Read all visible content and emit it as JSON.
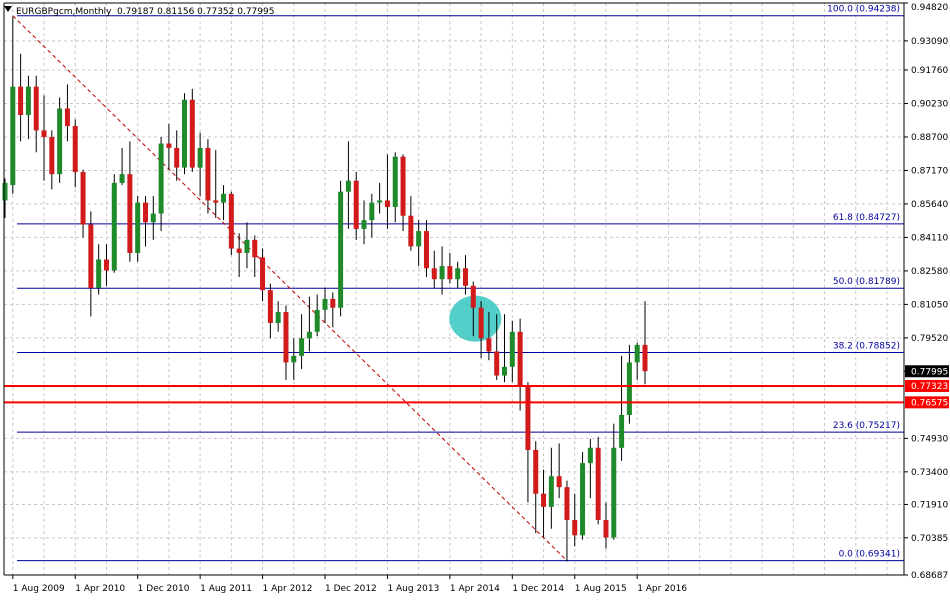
{
  "header": {
    "symbol": "EURGBPgcm,Monthly",
    "ohlc": "0.79187 0.81156 0.77352 0.77995"
  },
  "chart_data": {
    "type": "candlestick",
    "symbol": "EURGBPgcm",
    "timeframe": "Monthly",
    "ylim": [
      0.68687,
      0.9482
    ],
    "y_ticks": [
      "0.94820",
      "0.93090",
      "0.91760",
      "0.90230",
      "0.88700",
      "0.87170",
      "0.85640",
      "0.84110",
      "0.82580",
      "0.81050",
      "0.79520",
      "0.77995",
      "0.74930",
      "0.73400",
      "0.71910",
      "0.70385",
      "0.68687"
    ],
    "x_ticks": [
      "1 Aug 2009",
      "1 Apr 2010",
      "1 Dec 2010",
      "1 Aug 2011",
      "1 Apr 2012",
      "1 Dec 2012",
      "1 Aug 2013",
      "1 Apr 2014",
      "1 Dec 2014",
      "1 Aug 2015",
      "1 Apr 2016"
    ],
    "x_range": [
      "2009-07",
      "2016-05"
    ],
    "grid": true,
    "colors": {
      "bull": "#1f8a2a",
      "bear": "#d11a1a",
      "wick": "#000000",
      "grid": "#c8c8c8",
      "fib": "#0000a0",
      "sr": "#ff0000",
      "trend": "#c00000",
      "highlight": "#35c6c0",
      "price_label": "#000000",
      "sr_label": "#ff0000"
    },
    "fibonacci": [
      {
        "label": "100.0",
        "value": "0.94238"
      },
      {
        "label": "61.8",
        "value": "0.84727"
      },
      {
        "label": "50.0",
        "value": "0.81789"
      },
      {
        "label": "38.2",
        "value": "0.78852"
      },
      {
        "label": "23.6",
        "value": "0.75217"
      },
      {
        "label": "0.0",
        "value": "0.69341"
      }
    ],
    "support_resistance": [
      "0.77323",
      "0.76575"
    ],
    "current_price": "0.77995",
    "trendline": {
      "from_date": "2009-08",
      "from_price": 0.94238,
      "to_date": "2015-07",
      "to_price": 0.69341
    },
    "highlight": {
      "date": "2014-07",
      "price": 0.804
    },
    "candles": [
      {
        "t": "2009-07",
        "o": 0.858,
        "h": 0.868,
        "l": 0.85,
        "c": 0.866
      },
      {
        "t": "2009-08",
        "o": 0.865,
        "h": 0.942,
        "l": 0.861,
        "c": 0.91
      },
      {
        "t": "2009-09",
        "o": 0.91,
        "h": 0.925,
        "l": 0.885,
        "c": 0.897
      },
      {
        "t": "2009-10",
        "o": 0.897,
        "h": 0.915,
        "l": 0.886,
        "c": 0.91
      },
      {
        "t": "2009-11",
        "o": 0.91,
        "h": 0.915,
        "l": 0.88,
        "c": 0.89
      },
      {
        "t": "2009-12",
        "o": 0.89,
        "h": 0.906,
        "l": 0.867,
        "c": 0.887
      },
      {
        "t": "2010-01",
        "o": 0.887,
        "h": 0.89,
        "l": 0.863,
        "c": 0.87
      },
      {
        "t": "2010-02",
        "o": 0.87,
        "h": 0.905,
        "l": 0.866,
        "c": 0.9
      },
      {
        "t": "2010-03",
        "o": 0.9,
        "h": 0.911,
        "l": 0.885,
        "c": 0.892
      },
      {
        "t": "2010-04",
        "o": 0.892,
        "h": 0.895,
        "l": 0.864,
        "c": 0.871
      },
      {
        "t": "2010-05",
        "o": 0.871,
        "h": 0.872,
        "l": 0.841,
        "c": 0.847
      },
      {
        "t": "2010-06",
        "o": 0.847,
        "h": 0.853,
        "l": 0.805,
        "c": 0.818
      },
      {
        "t": "2010-07",
        "o": 0.818,
        "h": 0.838,
        "l": 0.815,
        "c": 0.831
      },
      {
        "t": "2010-08",
        "o": 0.831,
        "h": 0.838,
        "l": 0.819,
        "c": 0.826
      },
      {
        "t": "2010-09",
        "o": 0.826,
        "h": 0.87,
        "l": 0.825,
        "c": 0.866
      },
      {
        "t": "2010-10",
        "o": 0.866,
        "h": 0.882,
        "l": 0.865,
        "c": 0.87
      },
      {
        "t": "2010-11",
        "o": 0.87,
        "h": 0.885,
        "l": 0.83,
        "c": 0.834
      },
      {
        "t": "2010-12",
        "o": 0.834,
        "h": 0.86,
        "l": 0.83,
        "c": 0.857
      },
      {
        "t": "2011-01",
        "o": 0.857,
        "h": 0.86,
        "l": 0.837,
        "c": 0.848
      },
      {
        "t": "2011-02",
        "o": 0.848,
        "h": 0.86,
        "l": 0.84,
        "c": 0.852
      },
      {
        "t": "2011-03",
        "o": 0.852,
        "h": 0.887,
        "l": 0.844,
        "c": 0.884
      },
      {
        "t": "2011-04",
        "o": 0.884,
        "h": 0.893,
        "l": 0.872,
        "c": 0.882
      },
      {
        "t": "2011-05",
        "o": 0.882,
        "h": 0.89,
        "l": 0.867,
        "c": 0.873
      },
      {
        "t": "2011-06",
        "o": 0.873,
        "h": 0.907,
        "l": 0.87,
        "c": 0.904
      },
      {
        "t": "2011-07",
        "o": 0.904,
        "h": 0.909,
        "l": 0.871,
        "c": 0.873
      },
      {
        "t": "2011-08",
        "o": 0.873,
        "h": 0.889,
        "l": 0.86,
        "c": 0.882
      },
      {
        "t": "2011-09",
        "o": 0.882,
        "h": 0.886,
        "l": 0.852,
        "c": 0.858
      },
      {
        "t": "2011-10",
        "o": 0.858,
        "h": 0.881,
        "l": 0.85,
        "c": 0.857
      },
      {
        "t": "2011-11",
        "o": 0.857,
        "h": 0.865,
        "l": 0.849,
        "c": 0.861
      },
      {
        "t": "2011-12",
        "o": 0.861,
        "h": 0.862,
        "l": 0.833,
        "c": 0.836
      },
      {
        "t": "2012-01",
        "o": 0.836,
        "h": 0.843,
        "l": 0.823,
        "c": 0.834
      },
      {
        "t": "2012-02",
        "o": 0.834,
        "h": 0.848,
        "l": 0.827,
        "c": 0.84
      },
      {
        "t": "2012-03",
        "o": 0.84,
        "h": 0.842,
        "l": 0.823,
        "c": 0.832
      },
      {
        "t": "2012-04",
        "o": 0.832,
        "h": 0.836,
        "l": 0.812,
        "c": 0.817
      },
      {
        "t": "2012-05",
        "o": 0.817,
        "h": 0.82,
        "l": 0.795,
        "c": 0.802
      },
      {
        "t": "2012-06",
        "o": 0.802,
        "h": 0.812,
        "l": 0.798,
        "c": 0.807
      },
      {
        "t": "2012-07",
        "o": 0.807,
        "h": 0.81,
        "l": 0.776,
        "c": 0.784
      },
      {
        "t": "2012-08",
        "o": 0.784,
        "h": 0.795,
        "l": 0.776,
        "c": 0.787
      },
      {
        "t": "2012-09",
        "o": 0.787,
        "h": 0.806,
        "l": 0.781,
        "c": 0.795
      },
      {
        "t": "2012-10",
        "o": 0.795,
        "h": 0.814,
        "l": 0.789,
        "c": 0.798
      },
      {
        "t": "2012-11",
        "o": 0.798,
        "h": 0.815,
        "l": 0.796,
        "c": 0.808
      },
      {
        "t": "2012-12",
        "o": 0.808,
        "h": 0.818,
        "l": 0.802,
        "c": 0.813
      },
      {
        "t": "2013-01",
        "o": 0.813,
        "h": 0.816,
        "l": 0.8,
        "c": 0.809
      },
      {
        "t": "2013-02",
        "o": 0.809,
        "h": 0.867,
        "l": 0.805,
        "c": 0.862
      },
      {
        "t": "2013-03",
        "o": 0.862,
        "h": 0.885,
        "l": 0.845,
        "c": 0.867
      },
      {
        "t": "2013-04",
        "o": 0.867,
        "h": 0.871,
        "l": 0.84,
        "c": 0.845
      },
      {
        "t": "2013-05",
        "o": 0.845,
        "h": 0.858,
        "l": 0.838,
        "c": 0.849
      },
      {
        "t": "2013-06",
        "o": 0.849,
        "h": 0.861,
        "l": 0.841,
        "c": 0.857
      },
      {
        "t": "2013-07",
        "o": 0.857,
        "h": 0.866,
        "l": 0.852,
        "c": 0.858
      },
      {
        "t": "2013-08",
        "o": 0.858,
        "h": 0.879,
        "l": 0.845,
        "c": 0.855
      },
      {
        "t": "2013-09",
        "o": 0.855,
        "h": 0.88,
        "l": 0.848,
        "c": 0.878
      },
      {
        "t": "2013-10",
        "o": 0.878,
        "h": 0.879,
        "l": 0.844,
        "c": 0.851
      },
      {
        "t": "2013-11",
        "o": 0.851,
        "h": 0.86,
        "l": 0.835,
        "c": 0.837
      },
      {
        "t": "2013-12",
        "o": 0.837,
        "h": 0.849,
        "l": 0.828,
        "c": 0.844
      },
      {
        "t": "2014-01",
        "o": 0.844,
        "h": 0.849,
        "l": 0.823,
        "c": 0.827
      },
      {
        "t": "2014-02",
        "o": 0.827,
        "h": 0.835,
        "l": 0.818,
        "c": 0.822
      },
      {
        "t": "2014-03",
        "o": 0.822,
        "h": 0.837,
        "l": 0.815,
        "c": 0.828
      },
      {
        "t": "2014-04",
        "o": 0.828,
        "h": 0.834,
        "l": 0.82,
        "c": 0.822
      },
      {
        "t": "2014-05",
        "o": 0.822,
        "h": 0.83,
        "l": 0.818,
        "c": 0.827
      },
      {
        "t": "2014-06",
        "o": 0.827,
        "h": 0.833,
        "l": 0.815,
        "c": 0.819
      },
      {
        "t": "2014-07",
        "o": 0.819,
        "h": 0.821,
        "l": 0.796,
        "c": 0.809
      },
      {
        "t": "2014-08",
        "o": 0.809,
        "h": 0.812,
        "l": 0.786,
        "c": 0.795
      },
      {
        "t": "2014-09",
        "o": 0.795,
        "h": 0.807,
        "l": 0.785,
        "c": 0.789
      },
      {
        "t": "2014-10",
        "o": 0.789,
        "h": 0.806,
        "l": 0.776,
        "c": 0.778
      },
      {
        "t": "2014-11",
        "o": 0.778,
        "h": 0.806,
        "l": 0.775,
        "c": 0.782
      },
      {
        "t": "2014-12",
        "o": 0.782,
        "h": 0.803,
        "l": 0.775,
        "c": 0.798
      },
      {
        "t": "2015-01",
        "o": 0.798,
        "h": 0.804,
        "l": 0.762,
        "c": 0.773
      },
      {
        "t": "2015-02",
        "o": 0.773,
        "h": 0.775,
        "l": 0.72,
        "c": 0.744
      },
      {
        "t": "2015-03",
        "o": 0.744,
        "h": 0.748,
        "l": 0.706,
        "c": 0.724
      },
      {
        "t": "2015-04",
        "o": 0.724,
        "h": 0.735,
        "l": 0.704,
        "c": 0.718
      },
      {
        "t": "2015-05",
        "o": 0.718,
        "h": 0.745,
        "l": 0.708,
        "c": 0.732
      },
      {
        "t": "2015-06",
        "o": 0.732,
        "h": 0.747,
        "l": 0.722,
        "c": 0.727
      },
      {
        "t": "2015-07",
        "o": 0.727,
        "h": 0.73,
        "l": 0.693,
        "c": 0.712
      },
      {
        "t": "2015-08",
        "o": 0.712,
        "h": 0.724,
        "l": 0.7,
        "c": 0.705
      },
      {
        "t": "2015-09",
        "o": 0.705,
        "h": 0.743,
        "l": 0.703,
        "c": 0.738
      },
      {
        "t": "2015-10",
        "o": 0.738,
        "h": 0.749,
        "l": 0.722,
        "c": 0.745
      },
      {
        "t": "2015-11",
        "o": 0.745,
        "h": 0.75,
        "l": 0.71,
        "c": 0.712
      },
      {
        "t": "2015-12",
        "o": 0.712,
        "h": 0.72,
        "l": 0.699,
        "c": 0.704
      },
      {
        "t": "2016-01",
        "o": 0.704,
        "h": 0.756,
        "l": 0.703,
        "c": 0.745
      },
      {
        "t": "2016-02",
        "o": 0.745,
        "h": 0.787,
        "l": 0.739,
        "c": 0.76
      },
      {
        "t": "2016-03",
        "o": 0.76,
        "h": 0.792,
        "l": 0.756,
        "c": 0.784
      },
      {
        "t": "2016-04",
        "o": 0.784,
        "h": 0.793,
        "l": 0.776,
        "c": 0.792
      },
      {
        "t": "2016-05",
        "o": 0.792,
        "h": 0.812,
        "l": 0.774,
        "c": 0.78
      }
    ]
  }
}
